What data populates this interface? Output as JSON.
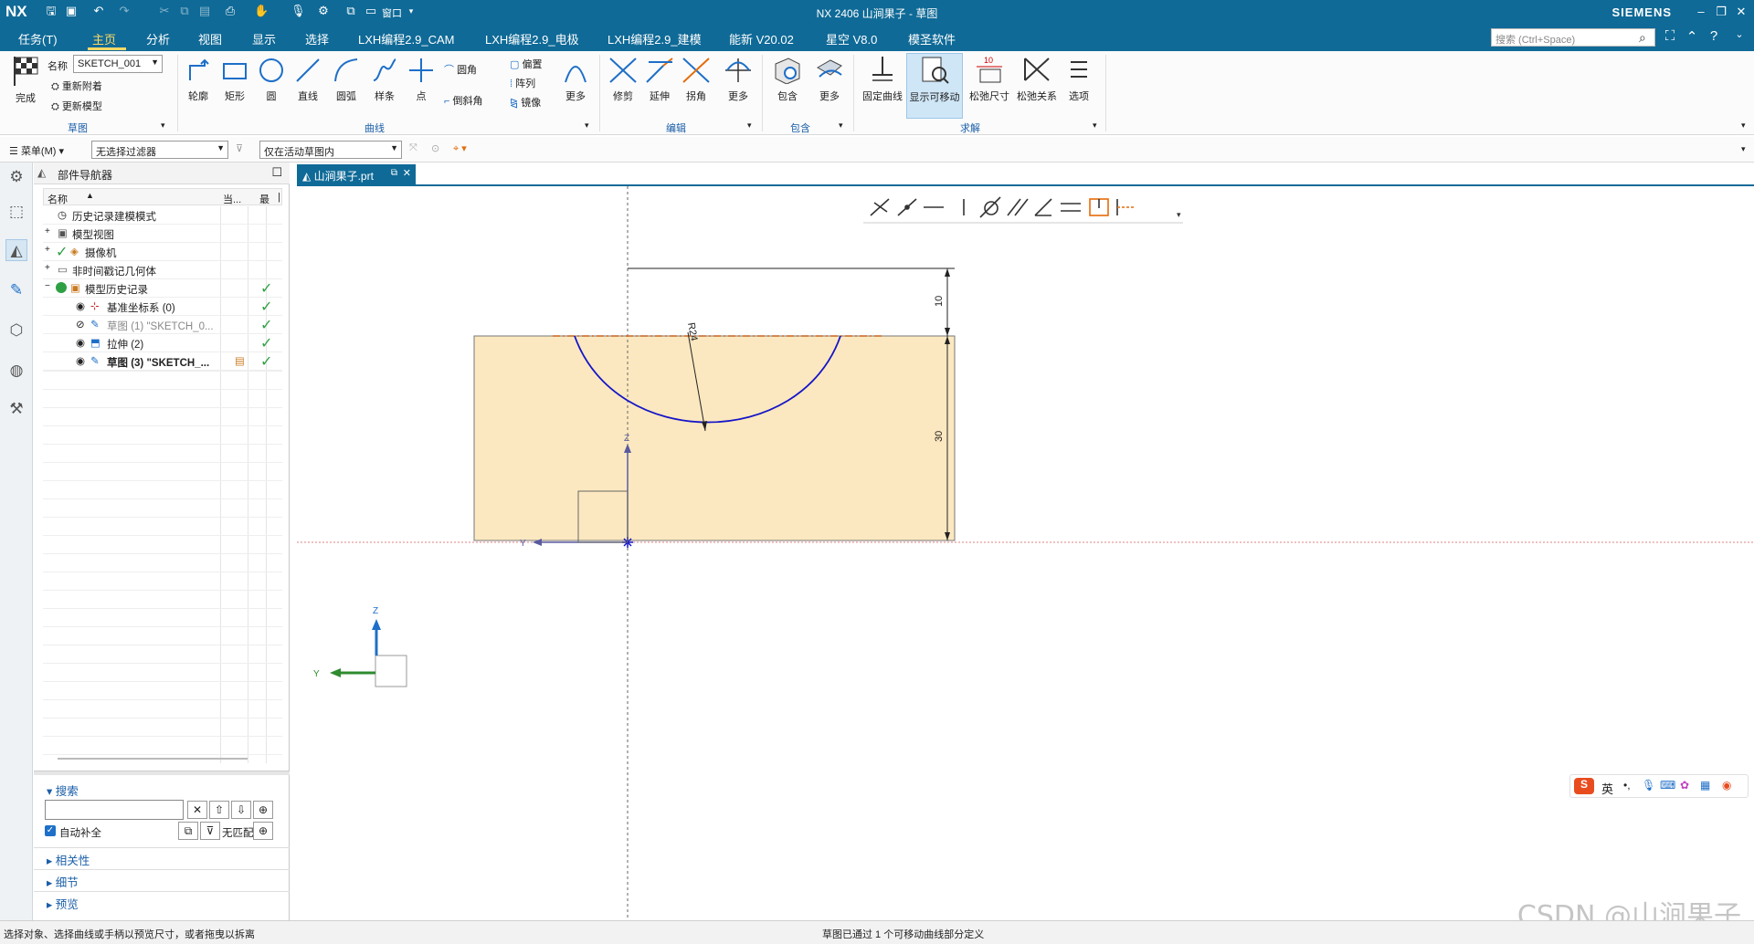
{
  "titlebar": {
    "app_logo": "NX",
    "window_menu": "窗口",
    "title": "NX 2406 山涧果子 - 草图",
    "brand": "SIEMENS"
  },
  "menubar": {
    "tabs": [
      "任务(T)",
      "主页",
      "分析",
      "视图",
      "显示",
      "选择",
      "LXH编程2.9_CAM",
      "LXH编程2.9_电极",
      "LXH编程2.9_建模",
      "能新 V20.02",
      "星空 V8.0",
      "模圣软件"
    ],
    "active_tab": "主页",
    "search_placeholder": "搜索 (Ctrl+Space)"
  },
  "ribbon": {
    "finish_label": "完成",
    "name_label": "名称",
    "sketch_name": "SKETCH_001",
    "reattach_label": "重新附着",
    "update_model_label": "更新模型",
    "group_sketch": "草图",
    "curve_tools": [
      "轮廓",
      "矩形",
      "圆",
      "直线",
      "圆弧",
      "样条",
      "点"
    ],
    "fillet_label": "圆角",
    "chamfer_label": "倒斜角",
    "offset_label": "偏置",
    "pattern_label": "阵列",
    "mirror_label": "镜像",
    "more_label": "更多",
    "group_curve": "曲线",
    "edit_tools": [
      "修剪",
      "延伸",
      "拐角"
    ],
    "group_edit": "编辑",
    "include_label": "包含",
    "group_include": "包含",
    "solve_tools": [
      "固定曲线",
      "显示可移动",
      "松弛尺寸",
      "松弛关系",
      "选项"
    ],
    "group_solve": "求解"
  },
  "filterbar": {
    "menu_label": "菜单(M)",
    "selection_filter": "无选择过滤器",
    "scope": "仅在活动草图内"
  },
  "navigator": {
    "title": "部件导航器",
    "columns": [
      "名称",
      "当...",
      "最",
      "|"
    ],
    "rows": [
      {
        "label": "历史记录建模模式",
        "indent": 1
      },
      {
        "label": "模型视图",
        "indent": 0
      },
      {
        "label": "摄像机",
        "indent": 0
      },
      {
        "label": "非时间戳记几何体",
        "indent": 0
      },
      {
        "label": "模型历史记录",
        "indent": 0
      },
      {
        "label": "基准坐标系 (0)",
        "indent": 2
      },
      {
        "label": "草图 (1) \"SKETCH_0...",
        "indent": 2
      },
      {
        "label": "拉伸 (2)",
        "indent": 2
      },
      {
        "label": "草图 (3) \"SKETCH_...",
        "indent": 2
      }
    ],
    "search_label": "搜索",
    "autocomplete_label": "自动补全",
    "nomatch_label": "无匹配",
    "sections": [
      "相关性",
      "细节",
      "预览"
    ]
  },
  "document": {
    "tab_label": "山涧果子.prt"
  },
  "sketch": {
    "radius_label": "R24",
    "dim_top": "10",
    "dim_side": "30",
    "axis_y": "Y",
    "axis_z": "Z"
  },
  "statusbar": {
    "left": "选择对象、选择曲线或手柄以预览尺寸，或者拖曳以拆离",
    "center": "草图已通过 1 个可移动曲线部分定义"
  },
  "watermark": "CSDN @山涧果子",
  "ime": {
    "lang": "英"
  },
  "colors": {
    "titlebar": "#0f6a97",
    "active_tab": "#ffd966",
    "sketch_fill": "#fce8c0",
    "arc": "#1515c8",
    "check": "#2ea043"
  }
}
